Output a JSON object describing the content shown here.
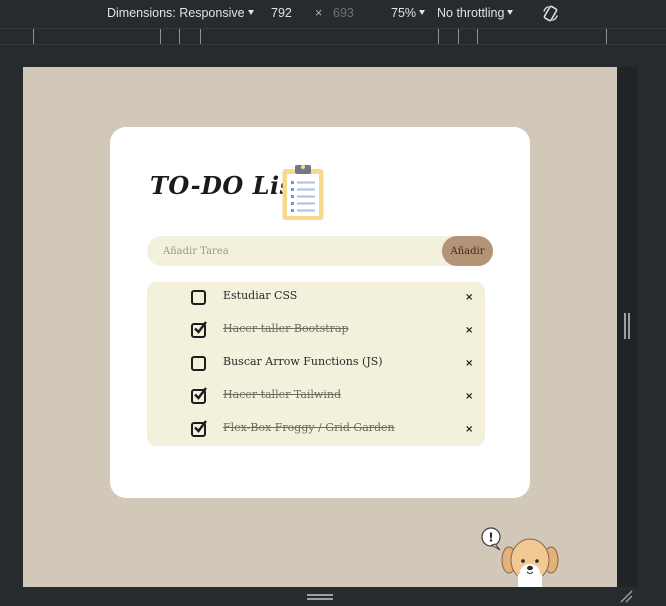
{
  "devtools": {
    "dimensions_label": "Dimensions: Responsive",
    "width_value": "792",
    "times_symbol": "×",
    "height_value": "693",
    "zoom_label": "75%",
    "throttling_label": "No throttling"
  },
  "app": {
    "title": "TO-DO List",
    "input_placeholder": "Añadir Tarea",
    "add_button_label": "Añadir",
    "delete_symbol": "×",
    "tasks": [
      {
        "label": "Estudiar CSS",
        "done": false
      },
      {
        "label": "Hacer taller Bootstrap",
        "done": true
      },
      {
        "label": "Buscar Arrow Functions (JS)",
        "done": false
      },
      {
        "label": "Hacer taller Tailwind",
        "done": true
      },
      {
        "label": "Flex-Box Froggy / Grid Garden",
        "done": true
      }
    ]
  },
  "colors": {
    "page_background": "#d1c8ba",
    "card": "#ffffff",
    "list_background": "#f3f1dc",
    "add_button": "#b49377"
  },
  "mascot": {
    "speech_symbol": "!"
  }
}
